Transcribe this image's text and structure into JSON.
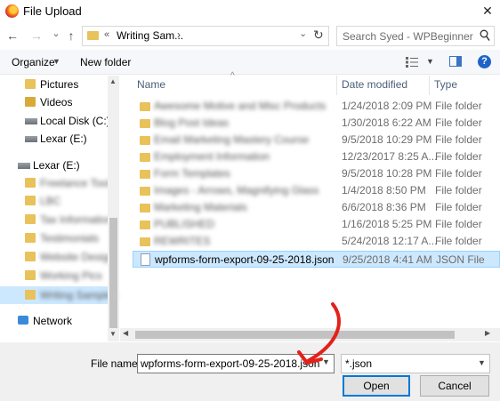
{
  "window": {
    "title": "File Upload",
    "close": "✕"
  },
  "nav": {
    "back": "←",
    "forward": "→",
    "history": "⌄",
    "up": "↑",
    "address_chevron": "«",
    "address_text": "Writing Sam...",
    "address_arrow": "›",
    "address_dropdown": "⌄",
    "refresh": "↻",
    "search_placeholder": "Search Syed - WPBeginner"
  },
  "toolbar": {
    "organize": "Organize",
    "caret": "▼",
    "new_folder": "New folder",
    "help": "?"
  },
  "sidebar": {
    "items": [
      {
        "label": "Pictures",
        "icon": "pictures-icon",
        "blurred": false
      },
      {
        "label": "Videos",
        "icon": "videos-icon",
        "blurred": false
      },
      {
        "label": "Local Disk (C:)",
        "icon": "drive-icon",
        "blurred": false
      },
      {
        "label": "Lexar (E:)",
        "icon": "usb-drive-icon",
        "blurred": false
      },
      {
        "label": "Lexar (E:)",
        "icon": "usb-drive-icon",
        "blurred": false
      },
      {
        "label": "Freelance Tools",
        "icon": "folder-icon",
        "blurred": true
      },
      {
        "label": "LBC",
        "icon": "folder-icon",
        "blurred": true
      },
      {
        "label": "Tax Information",
        "icon": "folder-icon",
        "blurred": true
      },
      {
        "label": "Testimonials",
        "icon": "folder-icon",
        "blurred": true
      },
      {
        "label": "Website Design",
        "icon": "folder-icon",
        "blurred": true
      },
      {
        "label": "Working Pics",
        "icon": "folder-icon",
        "blurred": true
      },
      {
        "label": "Writing Samples",
        "icon": "folder-icon",
        "blurred": true
      },
      {
        "label": "Network",
        "icon": "network-icon",
        "blurred": false
      }
    ]
  },
  "columns": {
    "name": "Name",
    "date": "Date modified",
    "type": "Type"
  },
  "files": [
    {
      "name": "Awesome Motive and Misc Products",
      "date": "1/24/2018 2:09 PM",
      "type": "File folder",
      "blurred": true
    },
    {
      "name": "Blog Post Ideas",
      "date": "1/30/2018 6:22 AM",
      "type": "File folder",
      "blurred": true
    },
    {
      "name": "Email Marketing Mastery Course",
      "date": "9/5/2018 10:29 PM",
      "type": "File folder",
      "blurred": true
    },
    {
      "name": "Employment Information",
      "date": "12/23/2017 8:25 A...",
      "type": "File folder",
      "blurred": true
    },
    {
      "name": "Form Templates",
      "date": "9/5/2018 10:28 PM",
      "type": "File folder",
      "blurred": true
    },
    {
      "name": "Images - Arrows, Magnifying Glass",
      "date": "1/4/2018 8:50 PM",
      "type": "File folder",
      "blurred": true
    },
    {
      "name": "Marketing Materials",
      "date": "6/6/2018 8:36 PM",
      "type": "File folder",
      "blurred": true
    },
    {
      "name": "PUBLISHED",
      "date": "1/16/2018 5:25 PM",
      "type": "File folder",
      "blurred": true
    },
    {
      "name": "REWRITES",
      "date": "5/24/2018 12:17 A...",
      "type": "File folder",
      "blurred": true
    },
    {
      "name": "wpforms-form-export-09-25-2018.json",
      "date": "9/25/2018 4:41 AM",
      "type": "JSON File",
      "blurred": false
    }
  ],
  "bottom": {
    "file_name_label": "File name:",
    "file_name_value": "wpforms-form-export-09-25-2018.json",
    "file_type_value": "*.json",
    "open": "Open",
    "cancel": "Cancel"
  },
  "colors": {
    "accent": "#0078d7",
    "selection": "#cce8ff",
    "folder": "#e8c25a",
    "annotation": "#e3211b"
  }
}
